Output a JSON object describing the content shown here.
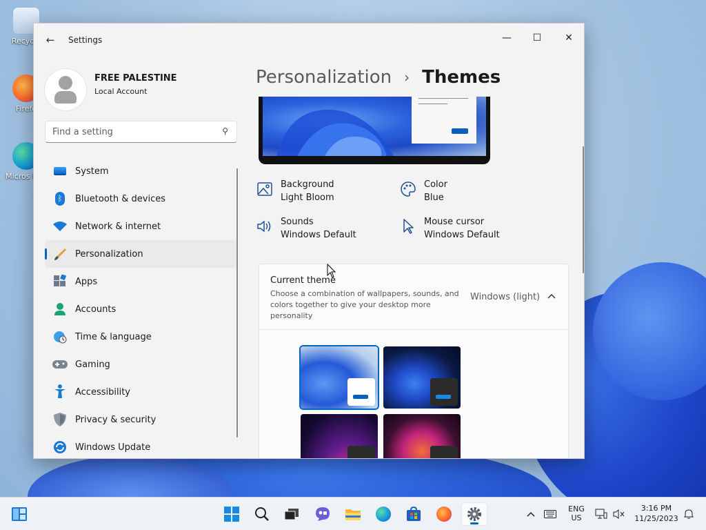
{
  "desktop": {
    "icons": [
      {
        "label": "Recycle",
        "icon": "recycle-bin-icon"
      },
      {
        "label": "Firefo",
        "icon": "firefox-icon"
      },
      {
        "label": "Micros Edg",
        "icon": "edge-icon"
      }
    ]
  },
  "window": {
    "title": "Settings",
    "controls": {
      "minimize": "—",
      "maximize": "☐",
      "close": "✕"
    }
  },
  "profile": {
    "name": "FREE PALESTINE",
    "account_type": "Local Account"
  },
  "search": {
    "placeholder": "Find a setting"
  },
  "nav": {
    "items": [
      {
        "label": "System",
        "icon": "system-icon"
      },
      {
        "label": "Bluetooth & devices",
        "icon": "bluetooth-icon"
      },
      {
        "label": "Network & internet",
        "icon": "wifi-icon"
      },
      {
        "label": "Personalization",
        "icon": "brush-icon",
        "active": true
      },
      {
        "label": "Apps",
        "icon": "apps-icon"
      },
      {
        "label": "Accounts",
        "icon": "person-icon"
      },
      {
        "label": "Time & language",
        "icon": "globe-clock-icon"
      },
      {
        "label": "Gaming",
        "icon": "gamepad-icon"
      },
      {
        "label": "Accessibility",
        "icon": "accessibility-icon"
      },
      {
        "label": "Privacy & security",
        "icon": "shield-icon"
      },
      {
        "label": "Windows Update",
        "icon": "update-icon"
      }
    ]
  },
  "breadcrumb": {
    "parent": "Personalization",
    "separator": "›",
    "current": "Themes"
  },
  "properties": {
    "background": {
      "title": "Background",
      "value": "Light Bloom"
    },
    "color": {
      "title": "Color",
      "value": "Blue"
    },
    "sounds": {
      "title": "Sounds",
      "value": "Windows Default"
    },
    "cursor": {
      "title": "Mouse cursor",
      "value": "Windows Default"
    }
  },
  "current_theme": {
    "title": "Current theme",
    "description": "Choose a combination of wallpapers, sounds, and colors together to give your desktop more personality",
    "value": "Windows (light)"
  },
  "taskbar": {
    "language": {
      "line1": "ENG",
      "line2": "US"
    },
    "clock": {
      "time": "3:16 PM",
      "date": "11/25/2023"
    }
  },
  "colors": {
    "accent": "#0067c0",
    "window_bg": "#f3f3f3",
    "taskbar_bg": "#eef1f6"
  }
}
